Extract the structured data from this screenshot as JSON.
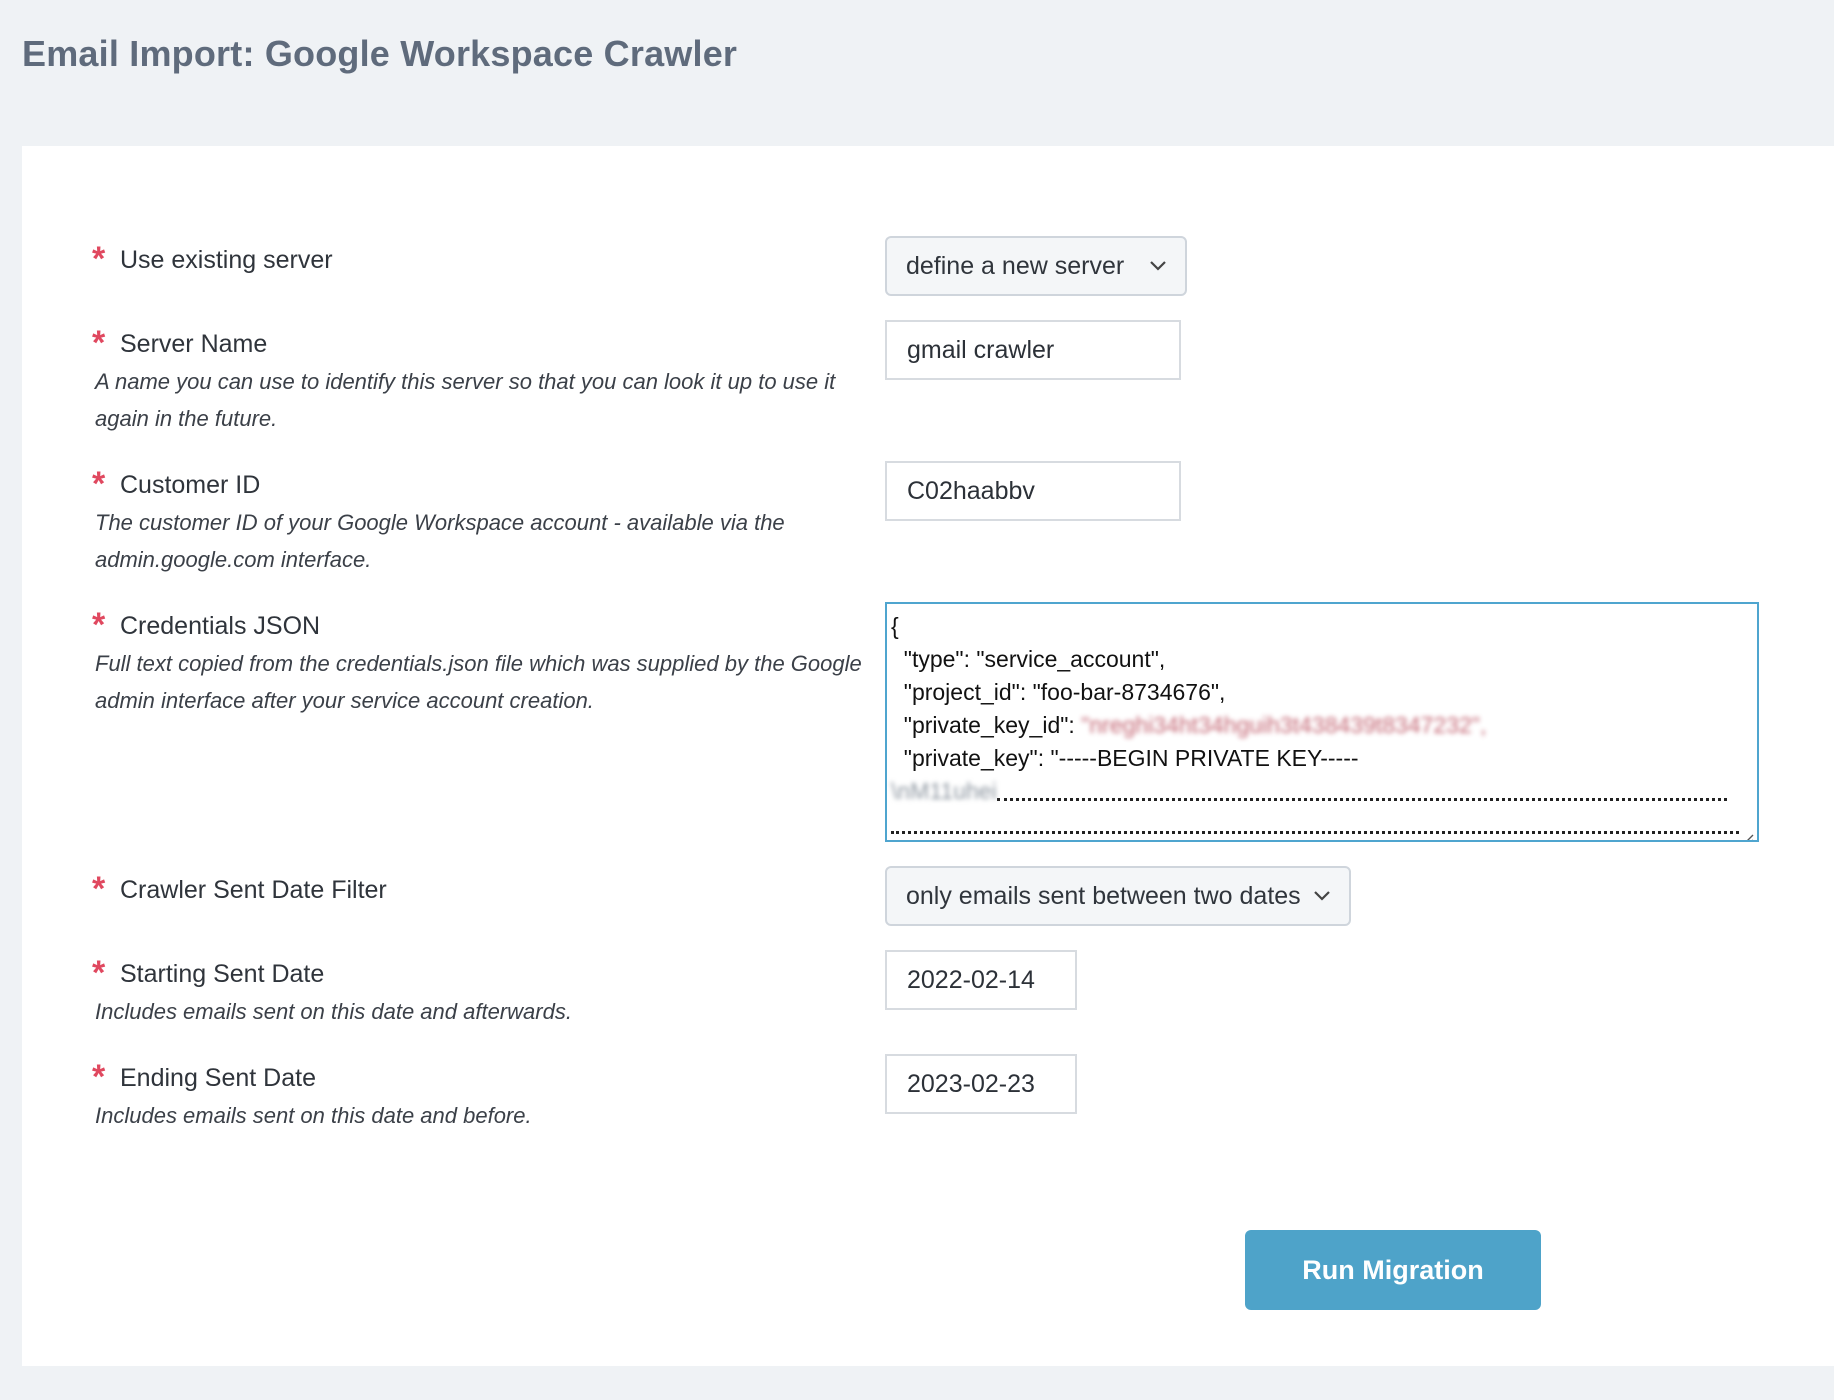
{
  "page": {
    "title": "Email Import: Google Workspace Crawler"
  },
  "fields": {
    "use_existing_server": {
      "label": "Use existing server",
      "selected": "define a new server"
    },
    "server_name": {
      "label": "Server Name",
      "help": "A name you can use to identify this server so that you can look it up to use it again in the future.",
      "value": "gmail crawler"
    },
    "customer_id": {
      "label": "Customer ID",
      "help": "The customer ID of your Google Workspace account - available via the admin.google.com interface.",
      "value": "C02haabbv"
    },
    "credentials_json": {
      "label": "Credentials JSON",
      "help": "Full text copied from the credentials.json file which was supplied by the Google admin interface after your service account creation.",
      "line1": "{",
      "line2": "  \"type\": \"service_account\",",
      "line3": "  \"project_id\": \"foo-bar-8734676\",",
      "line4_key": "  \"private_key_id\": ",
      "line4_value": "\"nreghi34ht34hguih3t438439t8347232\",",
      "line5": "  \"private_key\": \"-----BEGIN PRIVATE KEY-----",
      "line6_value": "\\nM11uhei"
    },
    "sent_date_filter": {
      "label": "Crawler Sent Date Filter",
      "selected": "only emails sent between two dates"
    },
    "starting_sent_date": {
      "label": "Starting Sent Date",
      "help": "Includes emails sent on this date and afterwards.",
      "value": "2022-02-14"
    },
    "ending_sent_date": {
      "label": "Ending Sent Date",
      "help": "Includes emails sent on this date and before.",
      "value": "2023-02-23"
    }
  },
  "actions": {
    "run_label": "Run Migration"
  },
  "colors": {
    "required_star": "#e0485f",
    "button": "#4ea3c9",
    "textarea_focus": "#4fa5cf"
  },
  "icons": {
    "required": "asterisk-icon",
    "select": "chevron-down-icon",
    "resize": "resize-grip-icon"
  }
}
